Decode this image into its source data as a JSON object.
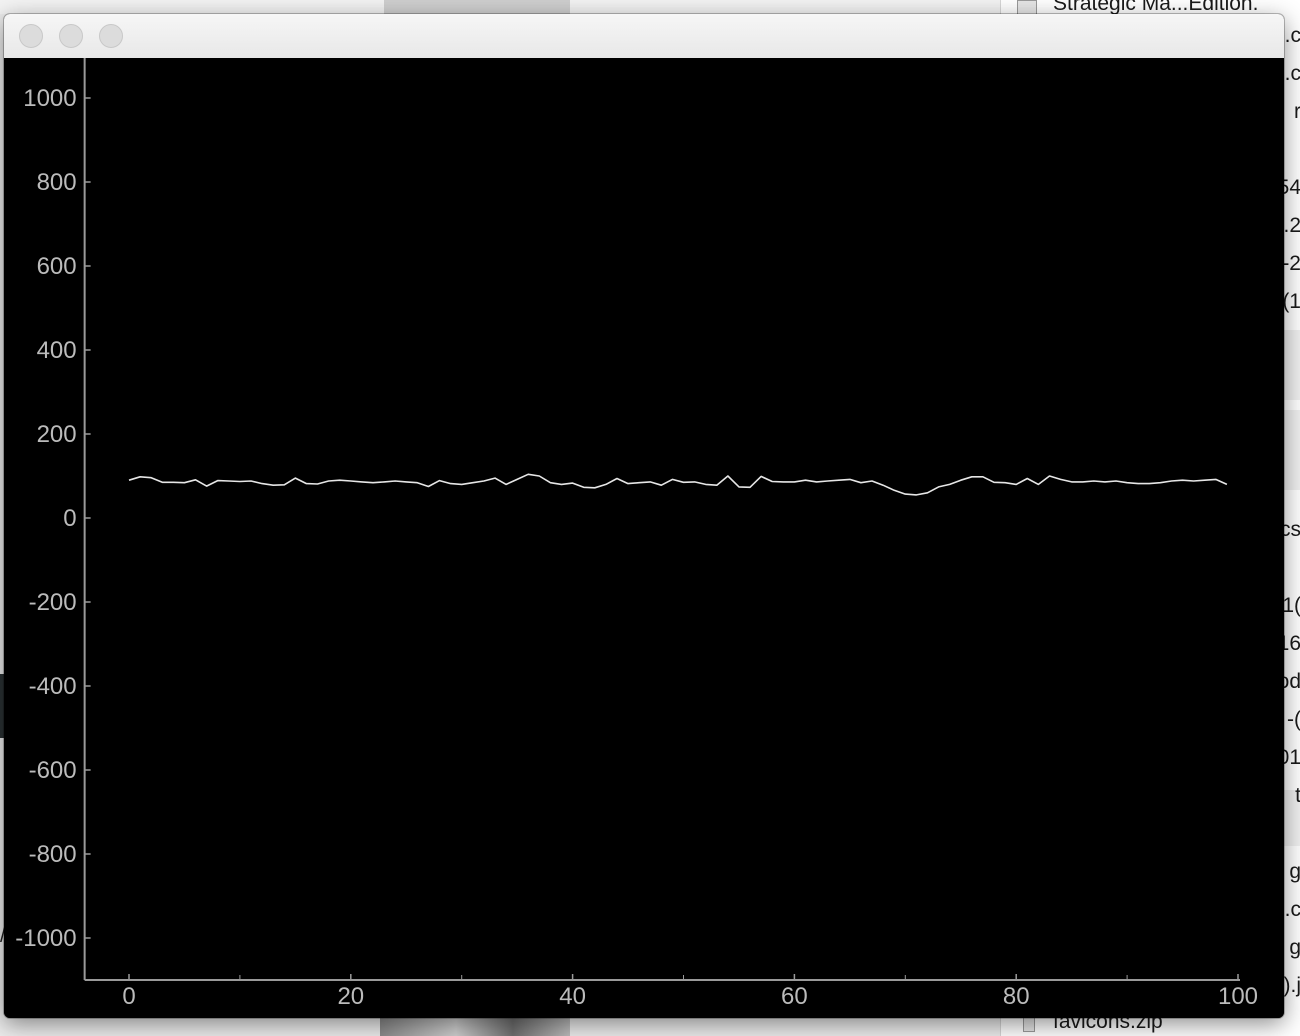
{
  "window": {
    "controls": [
      {
        "name": "close-button"
      },
      {
        "name": "minimize-button"
      },
      {
        "name": "zoom-button"
      }
    ]
  },
  "background": {
    "finder_rows": [
      "Strategic Ma...Edition.",
      ").c",
      ").c",
      "r",
      "54",
      ".2",
      "-2",
      "(1",
      "cs",
      "1(",
      "16",
      "od",
      "-(",
      "01",
      "t",
      "g",
      ".c",
      "g",
      ").j",
      "favicons.zip"
    ],
    "left_mark": "/"
  },
  "chart_data": {
    "type": "line",
    "xlim": [
      -4,
      100
    ],
    "ylim": [
      -1100,
      1100
    ],
    "xticks": [
      0,
      20,
      40,
      60,
      80,
      100
    ],
    "yticks": [
      1000,
      800,
      600,
      400,
      200,
      0,
      -200,
      -400,
      -600,
      -800,
      -1000
    ],
    "background": "#000000",
    "line_color": "#e6e6e6",
    "axis_color": "#9a9a9a",
    "tick_label_color": "#bbbbbb",
    "grid": false,
    "series": [
      {
        "x": [
          0,
          1,
          2,
          3,
          4,
          5,
          6,
          7,
          8,
          9,
          10,
          11,
          12,
          13,
          14,
          15,
          16,
          17,
          18,
          19,
          20,
          21,
          22,
          23,
          24,
          25,
          26,
          27,
          28,
          29,
          30,
          31,
          32,
          33,
          34,
          35,
          36,
          37,
          38,
          39,
          40,
          41,
          42,
          43,
          44,
          45,
          46,
          47,
          48,
          49,
          50,
          51,
          52,
          53,
          54,
          55,
          56,
          57,
          58,
          59,
          60,
          61,
          62,
          63,
          64,
          65,
          66,
          67,
          68,
          69,
          70,
          71,
          72,
          73,
          74,
          75,
          76,
          77,
          78,
          79,
          80,
          81,
          82,
          83,
          84,
          85,
          86,
          87,
          88,
          89,
          90,
          91,
          92,
          93,
          94,
          95,
          96,
          97,
          98,
          99
        ],
        "y": [
          90,
          98,
          96,
          85,
          85,
          84,
          91,
          76,
          89,
          88,
          87,
          88,
          82,
          78,
          79,
          95,
          82,
          81,
          88,
          90,
          88,
          86,
          84,
          86,
          88,
          86,
          84,
          75,
          89,
          82,
          80,
          84,
          88,
          95,
          80,
          92,
          104,
          100,
          84,
          80,
          83,
          73,
          72,
          80,
          94,
          82,
          84,
          86,
          78,
          92,
          85,
          86,
          80,
          78,
          100,
          74,
          73,
          99,
          87,
          86,
          86,
          90,
          86,
          88,
          90,
          92,
          84,
          88,
          78,
          66,
          57,
          55,
          60,
          74,
          80,
          90,
          98,
          98,
          85,
          84,
          80,
          94,
          80,
          100,
          92,
          86,
          86,
          88,
          86,
          88,
          84,
          82,
          82,
          84,
          88,
          90,
          88,
          90,
          92,
          80
        ]
      }
    ]
  }
}
